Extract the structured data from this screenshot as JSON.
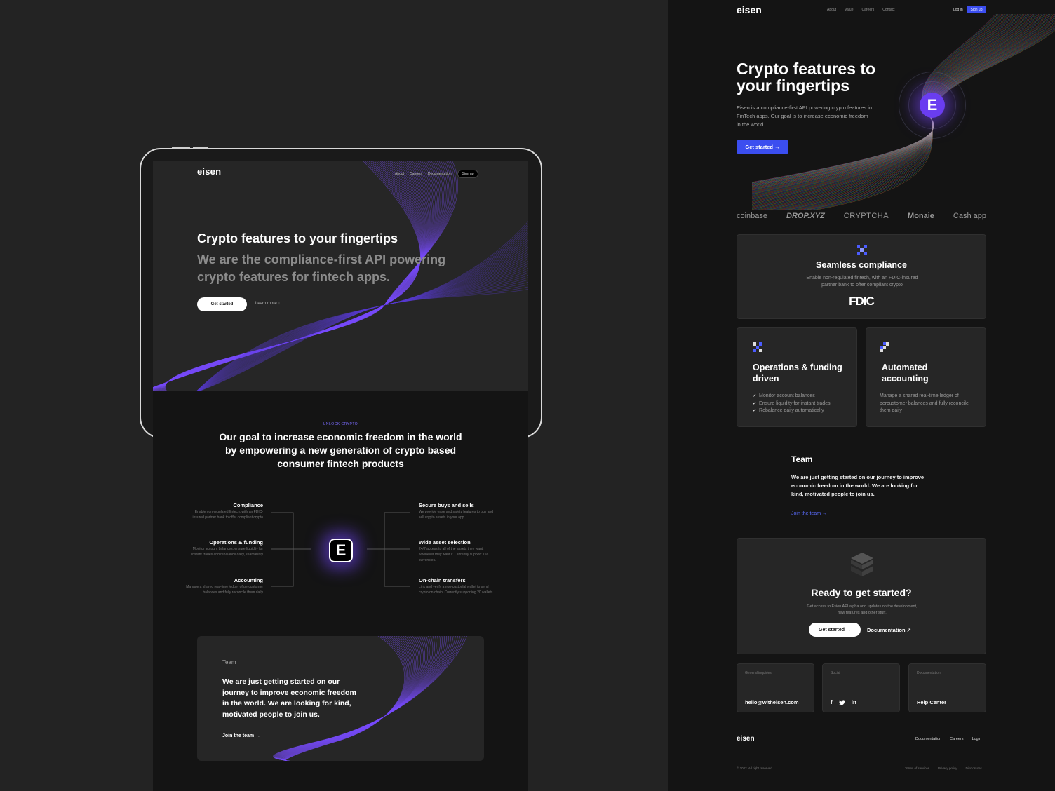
{
  "tablet": {
    "logo": "eisen",
    "nav": {
      "about": "About",
      "careers": "Careers",
      "docs": "Documentation",
      "signup": "Sign up"
    },
    "hero": {
      "title": "Crypto features to your fingertips",
      "subtitle": "We are the compliance-first API powering crypto features for fintech apps.",
      "cta": "Get started",
      "learn_more": "Learn more ↓"
    },
    "unlock": "UNLOCK CRYPTO",
    "goal": "Our goal to increase economic freedom in the world by empowering a new generation of crypto based consumer fintech products",
    "core_letter": "E",
    "features_left": [
      {
        "title": "Compliance",
        "desc": "Enable non-regulated fintech, with an FDIC-insured partner bank to offer compliant crypto"
      },
      {
        "title": "Operations & funding",
        "desc": "Monitor account balances, ensure liquidity for instant trades and rebalance daily, seamlessly"
      },
      {
        "title": "Accounting",
        "desc": "Manage a shared real-time ledger of percustomer balances and fully reconcile them daily"
      }
    ],
    "features_right": [
      {
        "title": "Secure buys and sells",
        "desc": "We provide ease and safety features to buy and sell crypto assets in your app."
      },
      {
        "title": "Wide asset selection",
        "desc": "24/7 access to all of the assets they want, whenever they want it. Currently support 156 currencies."
      },
      {
        "title": "On-chain transfers",
        "desc": "Link and verify a non-custodial wallet to send crypto on chain. Currently supporting 20 wallets"
      }
    ],
    "team": {
      "label": "Team",
      "text": "We are just getting started on our journey to improve economic freedom in the world. We are looking for kind, motivated people to join us.",
      "join": "Join the team →"
    }
  },
  "web": {
    "logo": "eisen",
    "nav": [
      "About",
      "Value",
      "Careers",
      "Contact"
    ],
    "login": "Log in",
    "signup": "Sign up",
    "hero": {
      "title": "Crypto features to your fingertips",
      "subtitle": "Eisen is a compliance-first API powering crypto features in FinTech apps. Our goal is to increase economic freedom in the world.",
      "cta": "Get started →",
      "badge_letter": "E"
    },
    "partners": [
      "coinbase",
      "DROP.XYZ",
      "CRYPTCHA",
      "Monaie",
      "Cash app"
    ],
    "compliance": {
      "title": "Seamless compliance",
      "desc": "Enable non-regulated fintech, with an FDIC-insured partner bank to offer compliant crypto",
      "logo_text": "FDIC"
    },
    "operations": {
      "title": "Operations & funding driven",
      "items": [
        "Monitor account balances",
        "Ensure liquidity for instant trades",
        "Rebalance daily automatically"
      ]
    },
    "accounting": {
      "title": "Automated accounting",
      "desc": "Manage a shared real-time ledger of percustomer balances and fully reconcile them daily"
    },
    "team": {
      "title": "Team",
      "desc": "We are just getting started on our journey to improve economic freedom in the world. We are looking for kind, motivated people to join us.",
      "join": "Join the team →"
    },
    "ready": {
      "title": "Ready to get started?",
      "desc": "Get access to Esien API alpha and updates on the development, new features and other stuff.",
      "cta": "Get started →",
      "docs": "Documentation ↗"
    },
    "contact": [
      {
        "label": "General inquiries",
        "value": "hello@witheisen.com"
      },
      {
        "label": "Social",
        "value": ""
      },
      {
        "label": "Documentation",
        "value": "Help Center"
      }
    ],
    "social_icons": [
      "facebook-icon",
      "twitter-icon",
      "linkedin-icon"
    ],
    "footer": {
      "logo": "eisen",
      "links": [
        "Documentation",
        "Careers",
        "Login"
      ],
      "copyright": "© 2022. All right reserved.",
      "legal": [
        "Terms of services",
        "Privacy policy",
        "Disclosures"
      ]
    },
    "colors": {
      "accent": "#3b4ef0",
      "purple": "#7a4dff"
    }
  }
}
